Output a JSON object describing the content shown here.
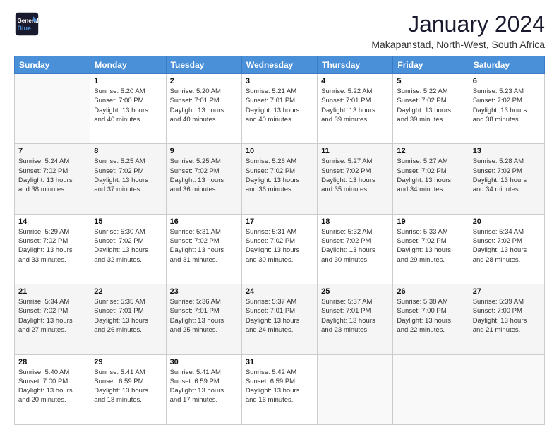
{
  "logo": {
    "line1": "General",
    "line2": "Blue"
  },
  "title": "January 2024",
  "location": "Makapanstad, North-West, South Africa",
  "weekdays": [
    "Sunday",
    "Monday",
    "Tuesday",
    "Wednesday",
    "Thursday",
    "Friday",
    "Saturday"
  ],
  "weeks": [
    [
      {
        "day": "",
        "info": ""
      },
      {
        "day": "1",
        "info": "Sunrise: 5:20 AM\nSunset: 7:00 PM\nDaylight: 13 hours\nand 40 minutes."
      },
      {
        "day": "2",
        "info": "Sunrise: 5:20 AM\nSunset: 7:01 PM\nDaylight: 13 hours\nand 40 minutes."
      },
      {
        "day": "3",
        "info": "Sunrise: 5:21 AM\nSunset: 7:01 PM\nDaylight: 13 hours\nand 40 minutes."
      },
      {
        "day": "4",
        "info": "Sunrise: 5:22 AM\nSunset: 7:01 PM\nDaylight: 13 hours\nand 39 minutes."
      },
      {
        "day": "5",
        "info": "Sunrise: 5:22 AM\nSunset: 7:02 PM\nDaylight: 13 hours\nand 39 minutes."
      },
      {
        "day": "6",
        "info": "Sunrise: 5:23 AM\nSunset: 7:02 PM\nDaylight: 13 hours\nand 38 minutes."
      }
    ],
    [
      {
        "day": "7",
        "info": "Sunrise: 5:24 AM\nSunset: 7:02 PM\nDaylight: 13 hours\nand 38 minutes."
      },
      {
        "day": "8",
        "info": "Sunrise: 5:25 AM\nSunset: 7:02 PM\nDaylight: 13 hours\nand 37 minutes."
      },
      {
        "day": "9",
        "info": "Sunrise: 5:25 AM\nSunset: 7:02 PM\nDaylight: 13 hours\nand 36 minutes."
      },
      {
        "day": "10",
        "info": "Sunrise: 5:26 AM\nSunset: 7:02 PM\nDaylight: 13 hours\nand 36 minutes."
      },
      {
        "day": "11",
        "info": "Sunrise: 5:27 AM\nSunset: 7:02 PM\nDaylight: 13 hours\nand 35 minutes."
      },
      {
        "day": "12",
        "info": "Sunrise: 5:27 AM\nSunset: 7:02 PM\nDaylight: 13 hours\nand 34 minutes."
      },
      {
        "day": "13",
        "info": "Sunrise: 5:28 AM\nSunset: 7:02 PM\nDaylight: 13 hours\nand 34 minutes."
      }
    ],
    [
      {
        "day": "14",
        "info": "Sunrise: 5:29 AM\nSunset: 7:02 PM\nDaylight: 13 hours\nand 33 minutes."
      },
      {
        "day": "15",
        "info": "Sunrise: 5:30 AM\nSunset: 7:02 PM\nDaylight: 13 hours\nand 32 minutes."
      },
      {
        "day": "16",
        "info": "Sunrise: 5:31 AM\nSunset: 7:02 PM\nDaylight: 13 hours\nand 31 minutes."
      },
      {
        "day": "17",
        "info": "Sunrise: 5:31 AM\nSunset: 7:02 PM\nDaylight: 13 hours\nand 30 minutes."
      },
      {
        "day": "18",
        "info": "Sunrise: 5:32 AM\nSunset: 7:02 PM\nDaylight: 13 hours\nand 30 minutes."
      },
      {
        "day": "19",
        "info": "Sunrise: 5:33 AM\nSunset: 7:02 PM\nDaylight: 13 hours\nand 29 minutes."
      },
      {
        "day": "20",
        "info": "Sunrise: 5:34 AM\nSunset: 7:02 PM\nDaylight: 13 hours\nand 28 minutes."
      }
    ],
    [
      {
        "day": "21",
        "info": "Sunrise: 5:34 AM\nSunset: 7:02 PM\nDaylight: 13 hours\nand 27 minutes."
      },
      {
        "day": "22",
        "info": "Sunrise: 5:35 AM\nSunset: 7:01 PM\nDaylight: 13 hours\nand 26 minutes."
      },
      {
        "day": "23",
        "info": "Sunrise: 5:36 AM\nSunset: 7:01 PM\nDaylight: 13 hours\nand 25 minutes."
      },
      {
        "day": "24",
        "info": "Sunrise: 5:37 AM\nSunset: 7:01 PM\nDaylight: 13 hours\nand 24 minutes."
      },
      {
        "day": "25",
        "info": "Sunrise: 5:37 AM\nSunset: 7:01 PM\nDaylight: 13 hours\nand 23 minutes."
      },
      {
        "day": "26",
        "info": "Sunrise: 5:38 AM\nSunset: 7:00 PM\nDaylight: 13 hours\nand 22 minutes."
      },
      {
        "day": "27",
        "info": "Sunrise: 5:39 AM\nSunset: 7:00 PM\nDaylight: 13 hours\nand 21 minutes."
      }
    ],
    [
      {
        "day": "28",
        "info": "Sunrise: 5:40 AM\nSunset: 7:00 PM\nDaylight: 13 hours\nand 20 minutes."
      },
      {
        "day": "29",
        "info": "Sunrise: 5:41 AM\nSunset: 6:59 PM\nDaylight: 13 hours\nand 18 minutes."
      },
      {
        "day": "30",
        "info": "Sunrise: 5:41 AM\nSunset: 6:59 PM\nDaylight: 13 hours\nand 17 minutes."
      },
      {
        "day": "31",
        "info": "Sunrise: 5:42 AM\nSunset: 6:59 PM\nDaylight: 13 hours\nand 16 minutes."
      },
      {
        "day": "",
        "info": ""
      },
      {
        "day": "",
        "info": ""
      },
      {
        "day": "",
        "info": ""
      }
    ]
  ]
}
